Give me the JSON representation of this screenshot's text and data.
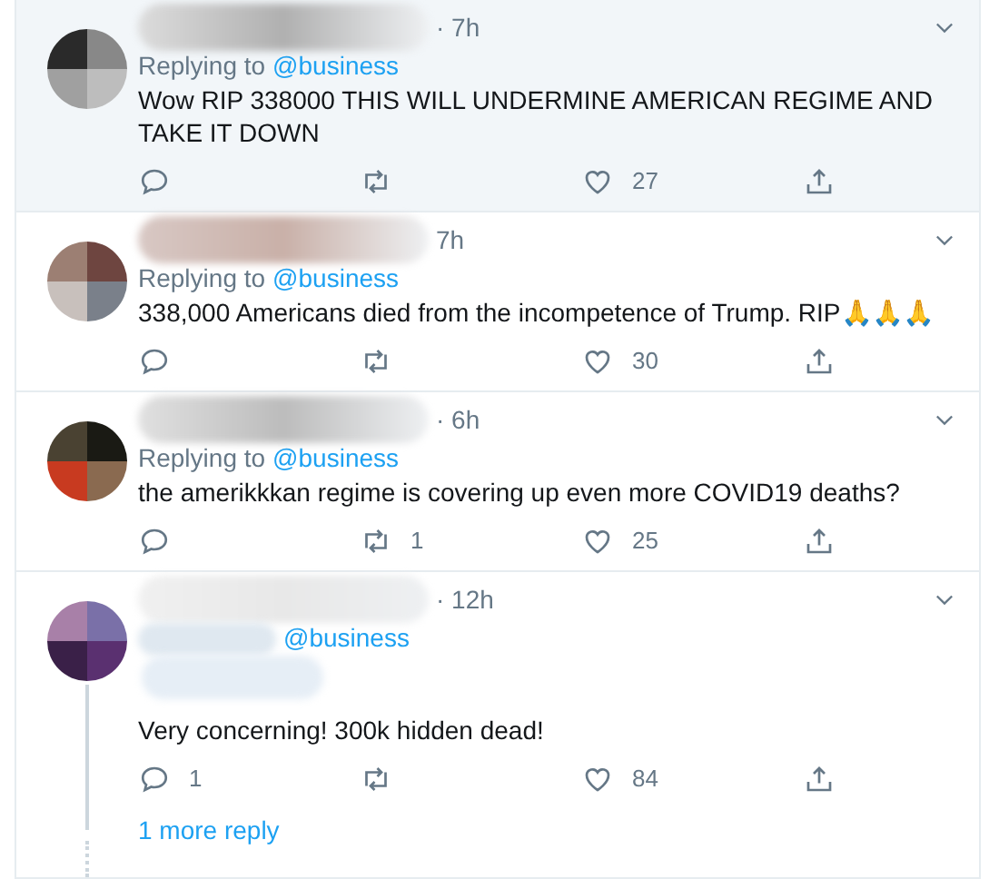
{
  "tweets": [
    {
      "hovered": true,
      "time": "· 7h",
      "replying_label": "Replying to",
      "reply_to": "@business",
      "text": "Wow RIP 338000 THIS WILL UNDERMINE AMERICAN REGIME AND TAKE IT DOWN",
      "likes": "27"
    },
    {
      "hovered": false,
      "time": "7h",
      "replying_label": "Replying to",
      "reply_to": "@business",
      "text": "338,000 Americans died from the incompetence of Trump. RIP🙏🙏🙏",
      "likes": "30"
    },
    {
      "hovered": false,
      "time": "· 6h",
      "replying_label": "Replying to",
      "reply_to": "@business",
      "text": "the amerikkkan regime is covering up even more COVID19 deaths?",
      "retweets": "1",
      "likes": "25"
    },
    {
      "hovered": false,
      "time": "· 12h",
      "reply_to": "@business",
      "text": "Very concerning! 300k hidden dead!",
      "replies": "1",
      "likes": "84",
      "thread_line": true,
      "more_replies": "1 more reply"
    }
  ]
}
